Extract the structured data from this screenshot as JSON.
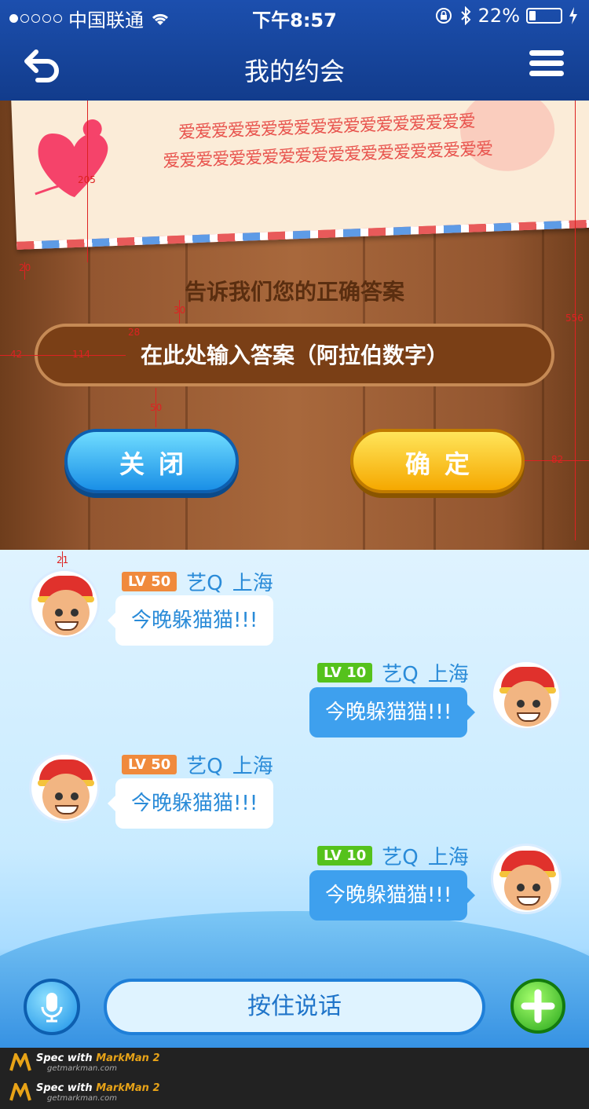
{
  "status_bar": {
    "carrier": "中国联通",
    "time": "下午8:57",
    "battery_percent": "22%",
    "battery_level": 0.22,
    "signal_icon": "signal-dots-icon",
    "wifi_icon": "wifi-icon",
    "lock_icon": "rotation-lock-icon",
    "bluetooth_icon": "bluetooth-icon",
    "charging_icon": "charging-icon"
  },
  "nav": {
    "title": "我的约会",
    "back_icon": "back-arrow-icon",
    "menu_icon": "hamburger-menu-icon"
  },
  "quiz": {
    "letter_line1": "爱爱爱爱爱爱爱爱爱爱爱爱爱爱爱爱爱爱",
    "letter_line2": "爱爱爱爱爱爱爱爱爱爱爱爱爱爱爱爱爱爱爱爱",
    "prompt": "告诉我们您的正确答案",
    "input_placeholder": "在此处输入答案（阿拉伯数字）",
    "close_label": "关闭",
    "confirm_label": "确定"
  },
  "spec_marks": {
    "letter_height": "205",
    "letter_gap": "20",
    "prompt_gap": "30",
    "input_pad_top": "28",
    "input_left": "42",
    "input_text_left": "114",
    "input_button_gap": "50",
    "panel_height": "556",
    "button_right": "82",
    "chat_top": "21"
  },
  "chat": {
    "messages": [
      {
        "side": "left",
        "level": "LV 50",
        "name": "艺Q",
        "city": "上海",
        "text": "今晚躲猫猫!!!"
      },
      {
        "side": "right",
        "level": "LV 10",
        "name": "艺Q",
        "city": "上海",
        "text": "今晚躲猫猫!!!"
      },
      {
        "side": "left",
        "level": "LV 50",
        "name": "艺Q",
        "city": "上海",
        "text": "今晚躲猫猫!!!"
      },
      {
        "side": "right",
        "level": "LV 10",
        "name": "艺Q",
        "city": "上海",
        "text": "今晚躲猫猫!!!"
      }
    ],
    "talk_label": "按住说话",
    "mic_icon": "microphone-icon",
    "plus_icon": "plus-icon"
  },
  "footer": {
    "brand_prefix": "Spec with ",
    "brand_name": "MarkMan 2",
    "site": "getmarkman.com"
  },
  "colors": {
    "nav_bg": "#1c4fae",
    "wood": "#a8683c",
    "close_blue": "#1a8fe6",
    "confirm_yellow": "#f5a800",
    "level_orange": "#f08a3c",
    "level_green": "#55c21c",
    "chat_text_blue": "#2a8bd8"
  }
}
